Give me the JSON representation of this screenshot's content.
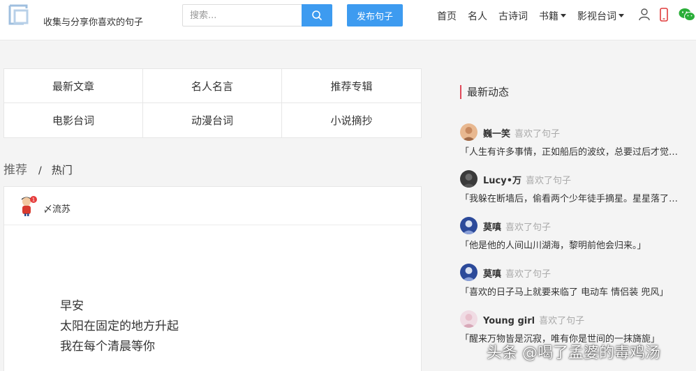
{
  "header": {
    "tagline": "收集与分享你喜欢的句子",
    "search_placeholder": "搜索...",
    "publish_label": "发布句子",
    "nav": [
      {
        "label": "首页"
      },
      {
        "label": "名人"
      },
      {
        "label": "古诗词"
      },
      {
        "label": "书籍"
      },
      {
        "label": "影视台词"
      }
    ]
  },
  "categories": [
    "最新文章",
    "名人名言",
    "推荐专辑",
    "电影台词",
    "动漫台词",
    "小说摘抄"
  ],
  "tabs": {
    "recommend": "推荐",
    "separator": "/",
    "hot": "热门"
  },
  "post": {
    "username": "〆流苏",
    "badge": "1",
    "lines": [
      "早安",
      "太阳在固定的地方升起",
      "我在每个清晨等你"
    ]
  },
  "sidebar": {
    "title": "最新动态",
    "activities": [
      {
        "name": "巍一笑",
        "action": "喜欢了句子",
        "text": "「人生有许多事情，正如船后的波纹，总要过后才觉得美的。」"
      },
      {
        "name": "Lucy•万",
        "action": "喜欢了句子",
        "text": "「我躲在断墙后，偷看两个少年徒手摘星。星星落了他们满身。」"
      },
      {
        "name": "莫嗔",
        "action": "喜欢了句子",
        "text": "「他是他的人间山川湖海，黎明前他会归来。」"
      },
      {
        "name": "莫嗔",
        "action": "喜欢了句子",
        "text": "「喜欢的日子马上就要来临了 电动车 情侣装 兜风」"
      },
      {
        "name": "Young girl",
        "action": "喜欢了句子",
        "text": "「醒来万物皆是沉寂，唯有你是世间的一抹旖旎」"
      }
    ]
  },
  "watermark": "头条 @喝了孟婆的毒鸡汤"
}
